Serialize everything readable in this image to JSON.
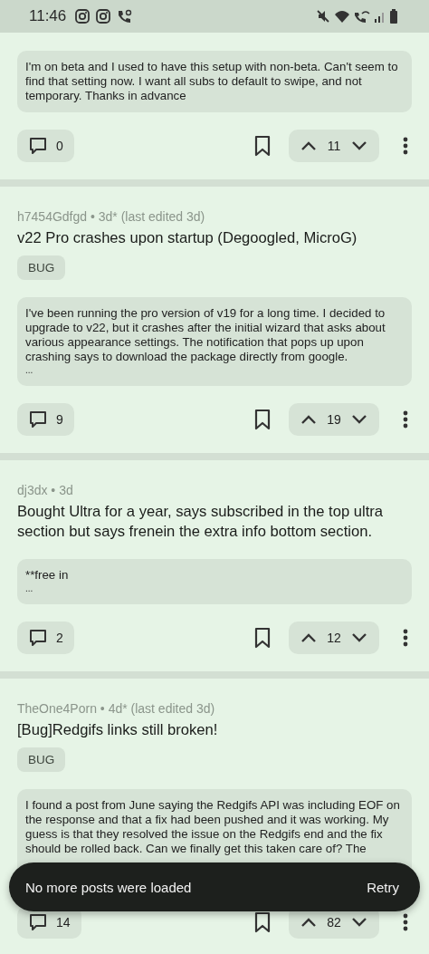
{
  "status_bar": {
    "time": "11:46"
  },
  "posts": [
    {
      "body": "I'm on beta and I used to have this setup with non-beta. Can't seem to find that setting now. I want all subs to default to swipe, and not temporary. Thanks in advance",
      "comments": "0",
      "votes": "11"
    },
    {
      "meta": "h7454Gdfgd • 3d* (last edited 3d)",
      "title": "v22 Pro crashes upon startup (Degoogled, MicroG)",
      "tag": "BUG",
      "body": "I've been running the pro version of v19 for a long time. I decided to upgrade to v22, but it crashes after the initial wizard that asks about various appearance settings. The notification that pops up upon crashing says to download the package directly from google.",
      "more": "...",
      "comments": "9",
      "votes": "19"
    },
    {
      "meta": "dj3dx • 3d",
      "title": "Bought Ultra for a year, says subscribed in the top ultra section but says frenein the extra info bottom section.",
      "body": "**free in",
      "more": "...",
      "comments": "2",
      "votes": "12"
    },
    {
      "meta": "TheOne4Porn • 4d* (last edited 3d)",
      "title": "[Bug]Redgifs links still broken!",
      "tag": "BUG",
      "body": "I found a post from June saying the Redgifs API was including EOF on the response and that a fix had been pushed and it was working. My guess is that they resolved the issue on the Redgifs end and the fix should be rolled back. Can we finally get this taken care of? The",
      "comments": "14",
      "votes": "82"
    }
  ],
  "snackbar": {
    "message": "No more posts were loaded",
    "action": "Retry"
  }
}
